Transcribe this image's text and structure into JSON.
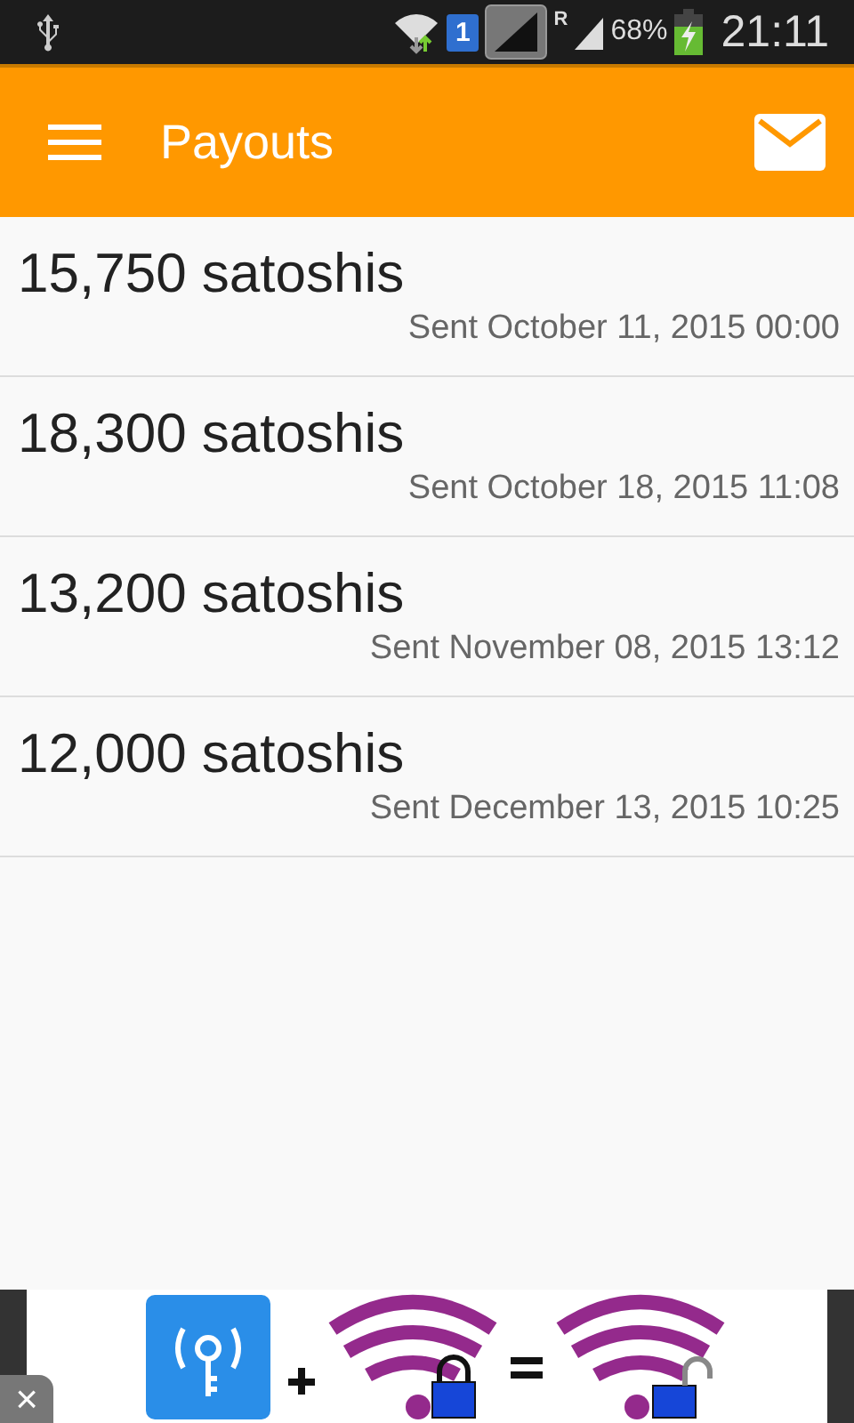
{
  "status_bar": {
    "sim_slot": "1",
    "roaming": "R",
    "battery": "68%",
    "time": "21:11"
  },
  "app_bar": {
    "title": "Payouts"
  },
  "payouts": [
    {
      "amount": "15,750 satoshis",
      "sent": "Sent October 11, 2015 00:00"
    },
    {
      "amount": "18,300 satoshis",
      "sent": "Sent October 18, 2015 11:08"
    },
    {
      "amount": "13,200 satoshis",
      "sent": "Sent November 08, 2015 13:12"
    },
    {
      "amount": "12,000 satoshis",
      "sent": "Sent December 13, 2015 10:25"
    }
  ],
  "ad": {
    "close": "×"
  }
}
